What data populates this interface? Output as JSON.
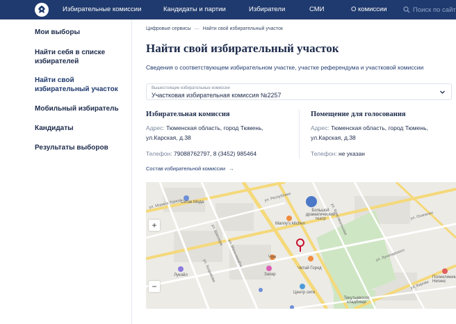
{
  "nav": {
    "items": [
      "Избирательные комиссии",
      "Кандидаты и партии",
      "Избиратели",
      "СМИ",
      "О комиссии"
    ],
    "search_placeholder": "Поиск по сайту"
  },
  "sidebar": {
    "items": [
      {
        "label": "Мои выборы"
      },
      {
        "label": "Найти себя в списке избирателей"
      },
      {
        "label": "Найти свой избирательный участок"
      },
      {
        "label": "Мобильный избиратель"
      },
      {
        "label": "Кандидаты"
      },
      {
        "label": "Результаты выборов"
      }
    ],
    "active_index": 2
  },
  "breadcrumb": {
    "items": [
      "Цифровые сервисы",
      "Найти свой избирательный участок"
    ]
  },
  "page_title": "Найти свой избирательный участок",
  "lead": "Сведения о соответствующем избирательном участке, участке референдума и участковой комиссии",
  "select": {
    "label": "Вышестоящие избирательные комиссии",
    "value": "Участковая избирательная комиссия №2257"
  },
  "commission": {
    "title": "Избирательная комиссия",
    "address_label": "Адрес:",
    "address_line1": "Тюменская область, город Тюмень,",
    "address_line2": "ул.Карская, д.38",
    "phone_label": "Телефон:",
    "phone": "79088762797, 8 (3452) 985464"
  },
  "voting_room": {
    "title": "Помещение для голосования",
    "address_label": "Адрес:",
    "address_line1": "Тюменская область, город Тюмень,",
    "address_line2": "ул.Карская, д.38",
    "phone_label": "Телефон:",
    "phone": "не указан"
  },
  "composition_link": "Состав избирательной комиссии",
  "map": {
    "zoom_in": "+",
    "zoom_out": "−",
    "pois": [
      "Ситак Мода",
      "Большой драматический театр",
      "Manny's kitchen",
      "Чум",
      "Захар",
      "Читай Город",
      "Лукойл",
      "Центр сити",
      "Текутьевское кладбище",
      "Поликлиника Нигинс"
    ],
    "streets": [
      "ул. Мориса Тореза",
      "ул. Шиллера",
      "ул. Республики",
      "ул. Мельникайте",
      "ул. Комсомольская",
      "ул. Осипенко",
      "ул. Хохрякова",
      "ул. Луначарского",
      "ул. Кирова"
    ]
  },
  "colors": {
    "nav_bg": "#1f3a6e",
    "accent": "#1f3a6e",
    "marker": "#c8102e"
  }
}
